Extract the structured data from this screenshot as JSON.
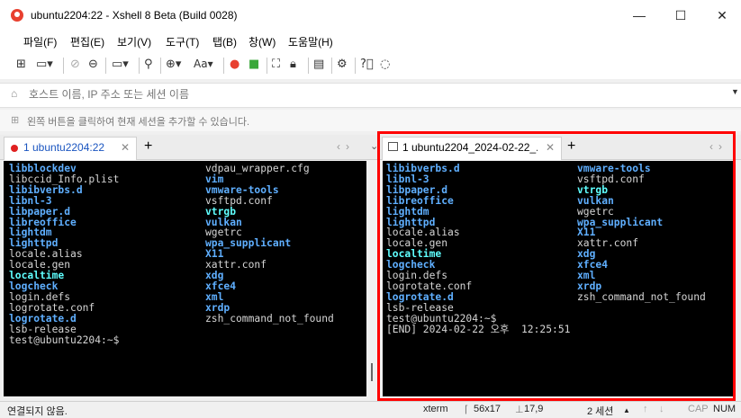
{
  "window": {
    "title": "ubuntu2204:22 - Xshell 8 Beta (Build 0028)",
    "minimize_glyph": "—",
    "maximize_glyph": "☐",
    "close_glyph": "✕"
  },
  "menu": [
    "파일(F)",
    "편집(E)",
    "보기(V)",
    "도구(T)",
    "탭(B)",
    "창(W)",
    "도움말(H)"
  ],
  "toolbar": {
    "icons": [
      "new-session-icon",
      "open-icon",
      "disconnect-icon",
      "reconnect-icon",
      "new-tab-icon",
      "find-icon",
      "globe-icon",
      "font-icon",
      "xftp-icon",
      "xmanager-icon",
      "fullscreen-icon",
      "lock-icon",
      "keyboard-icon",
      "settings-icon",
      "help-icon",
      "chat-icon"
    ],
    "font_label": "Aa"
  },
  "address": {
    "placeholder": "호스트 이름, IP 주소 또는 세션 이름"
  },
  "hint": {
    "text": "왼쪽 버튼을 클릭하여 현재 세션을 추가할 수 있습니다."
  },
  "tabs_left": {
    "active_label": "1 ubuntu2204:22",
    "status_color": "#e02020"
  },
  "tabs_right": {
    "active_label": "1 ubuntu2204_2024-02-22_..."
  },
  "terminal_left": {
    "col1": [
      {
        "t": "libblockdev",
        "s": "b"
      },
      {
        "t": "libccid_Info.plist",
        "s": "w"
      },
      {
        "t": "libibverbs.d",
        "s": "b"
      },
      {
        "t": "libnl-3",
        "s": "b"
      },
      {
        "t": "libpaper.d",
        "s": "b"
      },
      {
        "t": "libreoffice",
        "s": "b"
      },
      {
        "t": "lightdm",
        "s": "b"
      },
      {
        "t": "lighttpd",
        "s": "b"
      },
      {
        "t": "locale.alias",
        "s": "w"
      },
      {
        "t": "locale.gen",
        "s": "w"
      },
      {
        "t": "localtime",
        "s": "c"
      },
      {
        "t": "logcheck",
        "s": "b"
      },
      {
        "t": "login.defs",
        "s": "w"
      },
      {
        "t": "logrotate.conf",
        "s": "w"
      },
      {
        "t": "logrotate.d",
        "s": "b"
      },
      {
        "t": "lsb-release",
        "s": "w"
      },
      {
        "t": "test@ubuntu2204:~$",
        "s": "w"
      }
    ],
    "col2": [
      {
        "t": "vdpau_wrapper.cfg",
        "s": "w"
      },
      {
        "t": "vim",
        "s": "b"
      },
      {
        "t": "vmware-tools",
        "s": "b"
      },
      {
        "t": "vsftpd.conf",
        "s": "w"
      },
      {
        "t": "vtrgb",
        "s": "c"
      },
      {
        "t": "vulkan",
        "s": "b"
      },
      {
        "t": "wgetrc",
        "s": "w"
      },
      {
        "t": "wpa_supplicant",
        "s": "b"
      },
      {
        "t": "X11",
        "s": "b"
      },
      {
        "t": "xattr.conf",
        "s": "w"
      },
      {
        "t": "xdg",
        "s": "b"
      },
      {
        "t": "xfce4",
        "s": "b"
      },
      {
        "t": "xml",
        "s": "b"
      },
      {
        "t": "xrdp",
        "s": "b"
      },
      {
        "t": "zsh_command_not_found",
        "s": "w"
      }
    ]
  },
  "terminal_right": {
    "col1": [
      {
        "t": "libibverbs.d",
        "s": "b"
      },
      {
        "t": "libnl-3",
        "s": "b"
      },
      {
        "t": "libpaper.d",
        "s": "b"
      },
      {
        "t": "libreoffice",
        "s": "b"
      },
      {
        "t": "lightdm",
        "s": "b"
      },
      {
        "t": "lighttpd",
        "s": "b"
      },
      {
        "t": "locale.alias",
        "s": "w"
      },
      {
        "t": "locale.gen",
        "s": "w"
      },
      {
        "t": "localtime",
        "s": "c"
      },
      {
        "t": "logcheck",
        "s": "b"
      },
      {
        "t": "login.defs",
        "s": "w"
      },
      {
        "t": "logrotate.conf",
        "s": "w"
      },
      {
        "t": "logrotate.d",
        "s": "b"
      },
      {
        "t": "lsb-release",
        "s": "w"
      },
      {
        "t": "test@ubuntu2204:~$",
        "s": "w"
      },
      {
        "t": "[END] 2024-02-22 오후  12:25:51",
        "s": "w"
      }
    ],
    "col2": [
      {
        "t": "vmware-tools",
        "s": "b"
      },
      {
        "t": "vsftpd.conf",
        "s": "w"
      },
      {
        "t": "vtrgb",
        "s": "c"
      },
      {
        "t": "vulkan",
        "s": "b"
      },
      {
        "t": "wgetrc",
        "s": "w"
      },
      {
        "t": "wpa_supplicant",
        "s": "b"
      },
      {
        "t": "X11",
        "s": "b"
      },
      {
        "t": "xattr.conf",
        "s": "w"
      },
      {
        "t": "xdg",
        "s": "b"
      },
      {
        "t": "xfce4",
        "s": "b"
      },
      {
        "t": "xml",
        "s": "b"
      },
      {
        "t": "xrdp",
        "s": "b"
      },
      {
        "t": "zsh_command_not_found",
        "s": "w"
      }
    ]
  },
  "status": {
    "connection": "연결되지 않음.",
    "term_type": "xterm",
    "size": "56x17",
    "cursor": "17,9",
    "sessions": "2 세션",
    "caps": "CAP",
    "num": "NUM"
  },
  "colors": {
    "highlight": "#ff0000",
    "dir_text": "#5fafff",
    "link_text": "#5fffff",
    "terminal_bg": "#000000"
  }
}
